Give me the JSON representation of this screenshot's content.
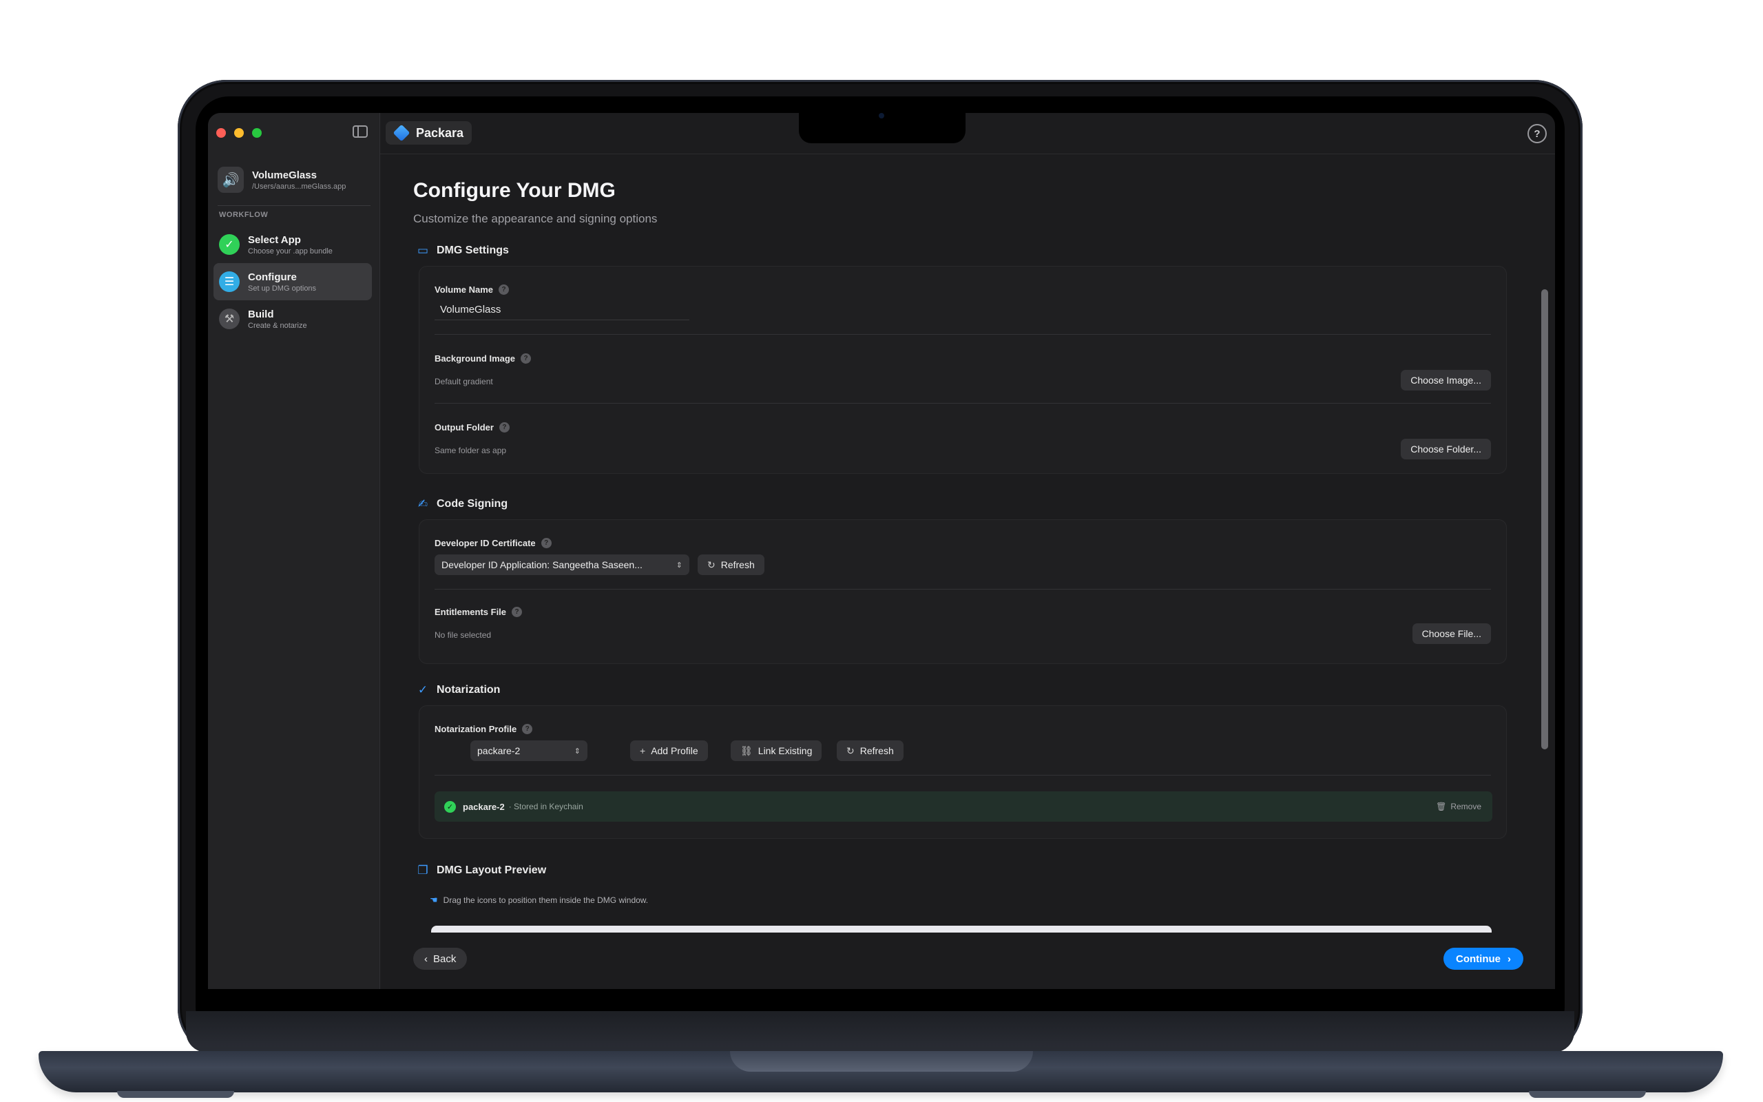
{
  "window": {
    "app_name": "Packara",
    "help_glyph": "?"
  },
  "sidebar": {
    "app": {
      "name": "VolumeGlass",
      "path": "/Users/aarus...meGlass.app",
      "icon": "speaker-icon"
    },
    "section_label": "WORKFLOW",
    "steps": [
      {
        "title": "Select App",
        "subtitle": "Choose your .app bundle",
        "state": "done",
        "icon": "checkmark-icon",
        "glyph": "✓"
      },
      {
        "title": "Configure",
        "subtitle": "Set up DMG options",
        "state": "active",
        "icon": "list-icon",
        "glyph": "☰"
      },
      {
        "title": "Build",
        "subtitle": "Create & notarize",
        "state": "pending",
        "icon": "hammer-icon",
        "glyph": "⚒"
      }
    ]
  },
  "main": {
    "title": "Configure Your DMG",
    "subtitle": "Customize the appearance and signing options",
    "dmg_settings": {
      "heading": "DMG Settings",
      "icon": "drive-icon",
      "volume_name": {
        "label": "Volume Name",
        "value": "VolumeGlass"
      },
      "background_image": {
        "label": "Background Image",
        "value": "Default gradient",
        "button": "Choose Image..."
      },
      "output_folder": {
        "label": "Output Folder",
        "value": "Same folder as app",
        "button": "Choose Folder..."
      }
    },
    "code_signing": {
      "heading": "Code Signing",
      "icon": "signature-icon",
      "certificate": {
        "label": "Developer ID Certificate",
        "selected": "Developer ID Application: Sangeetha Saseen...",
        "refresh": "Refresh"
      },
      "entitlements": {
        "label": "Entitlements File",
        "value": "No file selected",
        "button": "Choose File..."
      }
    },
    "notarization": {
      "heading": "Notarization",
      "icon": "checkmark-seal-icon",
      "profile": {
        "label": "Notarization Profile",
        "selected": "packare-2",
        "add": "Add Profile",
        "link": "Link Existing",
        "refresh": "Refresh"
      },
      "keychain": {
        "name": "packare-2",
        "status": "· Stored in Keychain",
        "remove": "Remove"
      }
    },
    "layout_preview": {
      "heading": "DMG Layout Preview",
      "icon": "windows-icon",
      "hint": "Drag the icons to position them inside the DMG window."
    }
  },
  "footer": {
    "back": "Back",
    "continue": "Continue"
  },
  "colors": {
    "accent": "#0a84ff",
    "success": "#30d158",
    "window_bg": "#1c1c1e"
  }
}
